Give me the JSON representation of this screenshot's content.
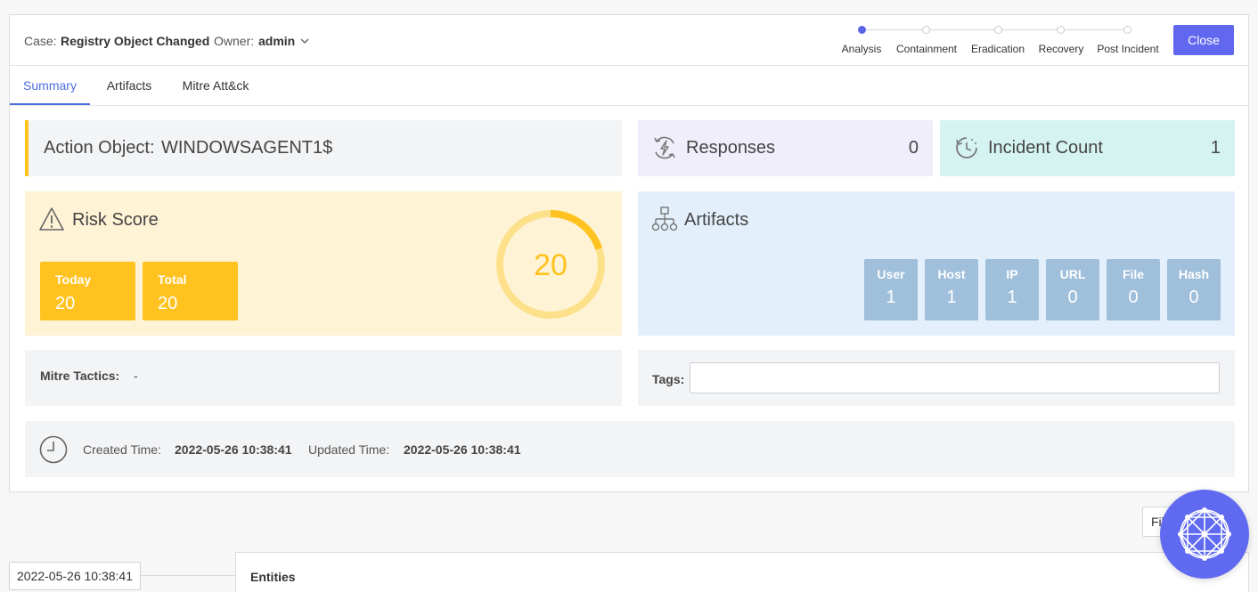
{
  "header": {
    "case_label": "Case:",
    "case_title": "Registry Object Changed",
    "owner_label": "Owner:",
    "owner_value": "admin",
    "close_label": "Close"
  },
  "stepper": {
    "steps": [
      "Analysis",
      "Containment",
      "Eradication",
      "Recovery",
      "Post Incident"
    ],
    "active_index": 0
  },
  "tabs": [
    "Summary",
    "Artifacts",
    "Mitre Att&ck"
  ],
  "active_tab": "Summary",
  "action_object": {
    "label": "Action Object:",
    "value": "WINDOWSAGENT1$"
  },
  "responses": {
    "label": "Responses",
    "value": "0"
  },
  "incident_count": {
    "label": "Incident Count",
    "value": "1"
  },
  "risk_score": {
    "title": "Risk Score",
    "today_label": "Today",
    "today_value": "20",
    "total_label": "Total",
    "total_value": "20",
    "gauge_value": "20",
    "gauge_fraction": 0.2
  },
  "artifacts": {
    "title": "Artifacts",
    "items": [
      {
        "label": "User",
        "value": "1"
      },
      {
        "label": "Host",
        "value": "1"
      },
      {
        "label": "IP",
        "value": "1"
      },
      {
        "label": "URL",
        "value": "0"
      },
      {
        "label": "File",
        "value": "0"
      },
      {
        "label": "Hash",
        "value": "0"
      }
    ]
  },
  "mitre": {
    "label": "Mitre Tactics:",
    "value": "-"
  },
  "tags": {
    "label": "Tags:",
    "value": ""
  },
  "times": {
    "created_label": "Created Time:",
    "created_value": "2022-05-26 10:38:41",
    "updated_label": "Updated Time:",
    "updated_value": "2022-05-26 10:38:41"
  },
  "filter": {
    "label": "Filter"
  },
  "timeline": {
    "date": "2022-05-26 10:38:41"
  },
  "entities": {
    "title": "Entities"
  },
  "colors": {
    "accent": "#6267f0",
    "tab_active": "#4e6ce0",
    "risk_yellow": "#ffc21f",
    "risk_bg": "#fff3d6",
    "artifact_box": "#9fbfdb",
    "artifact_bg": "#e3f0fb",
    "responses_bg": "#efeefa",
    "incident_bg": "#d5f4f1"
  },
  "icons": {
    "responses": "lightning-cycle-icon",
    "incident": "history-clock-icon",
    "risk": "warning-triangle-icon",
    "artifacts": "hierarchy-icon",
    "time": "clock-icon",
    "owner_dropdown": "chevron-down-icon",
    "fab": "network-graph-icon"
  }
}
